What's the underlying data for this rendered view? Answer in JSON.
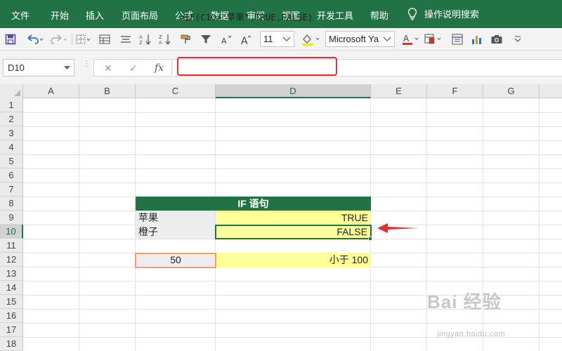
{
  "ribbon": {
    "tabs": [
      "文件",
      "开始",
      "插入",
      "页面布局",
      "公式",
      "数据",
      "审阅",
      "视图",
      "开发工具",
      "帮助"
    ],
    "help_search": "操作说明搜索"
  },
  "toolbar": {
    "font_size": "11",
    "font_name": "Microsoft Ya"
  },
  "formula_bar": {
    "name_box": "D10",
    "formula": "=IF(C10=\"苹果\",TRUE,FALSE)"
  },
  "grid": {
    "columns": [
      "A",
      "B",
      "C",
      "D",
      "E",
      "F",
      "G"
    ],
    "rows": [
      "1",
      "2",
      "3",
      "4",
      "5",
      "6",
      "7",
      "8",
      "9",
      "10",
      "11",
      "12",
      "13",
      "14",
      "15",
      "16",
      "17",
      "18"
    ],
    "active_column": "D",
    "active_row": "10"
  },
  "cells": {
    "title": "IF 语句",
    "c9": "苹果",
    "d9": "TRUE",
    "c10": "橙子",
    "d10": "FALSE",
    "c12": "50",
    "d12": "小于 100"
  },
  "colors": {
    "excel_green": "#217346",
    "highlight_red": "#e0312c",
    "cell_yellow": "#ffff99",
    "cell_orange_border": "#f0a070"
  },
  "watermark": {
    "brand": "Bai 经验",
    "url": "jingyan.baidu.com"
  }
}
